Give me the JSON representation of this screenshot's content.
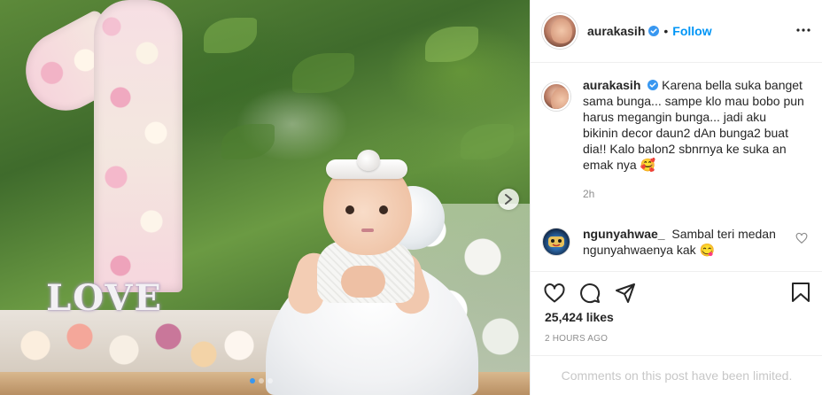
{
  "post_image": {
    "description_icon": "birthday-photo",
    "decor_numeral": "1",
    "decor_sign_text": "LOVE",
    "carousel_dots": 3,
    "active_dot": 1
  },
  "header": {
    "username": "aurakasih",
    "separator": "•",
    "follow_label": "Follow",
    "more_icon": "more-horizontal-icon"
  },
  "caption": {
    "username": "aurakasih",
    "text": "Karena bella suka banget sama bunga... sampe klo mau bobo pun harus megangin bunga... jadi aku bikinin decor daun2 dAn bunga2 buat dia!! Kalo balon2 sbnrnya ke suka an emak nya 🥰",
    "time": "2h"
  },
  "comments": [
    {
      "username": "ngunyahwae_",
      "text": "Sambal teri medan ngunyahwaenya kak 😋"
    }
  ],
  "actions": {
    "like_icon": "heart-icon",
    "comment_icon": "comment-icon",
    "share_icon": "share-icon",
    "save_icon": "bookmark-icon"
  },
  "likes": "25,424 likes",
  "post_time": "2 HOURS AGO",
  "comments_limited": "Comments on this post have been limited.",
  "colors": {
    "accent": "#0095f6",
    "verified": "#3897f0",
    "text": "#262626",
    "muted": "#8e8e8e"
  }
}
